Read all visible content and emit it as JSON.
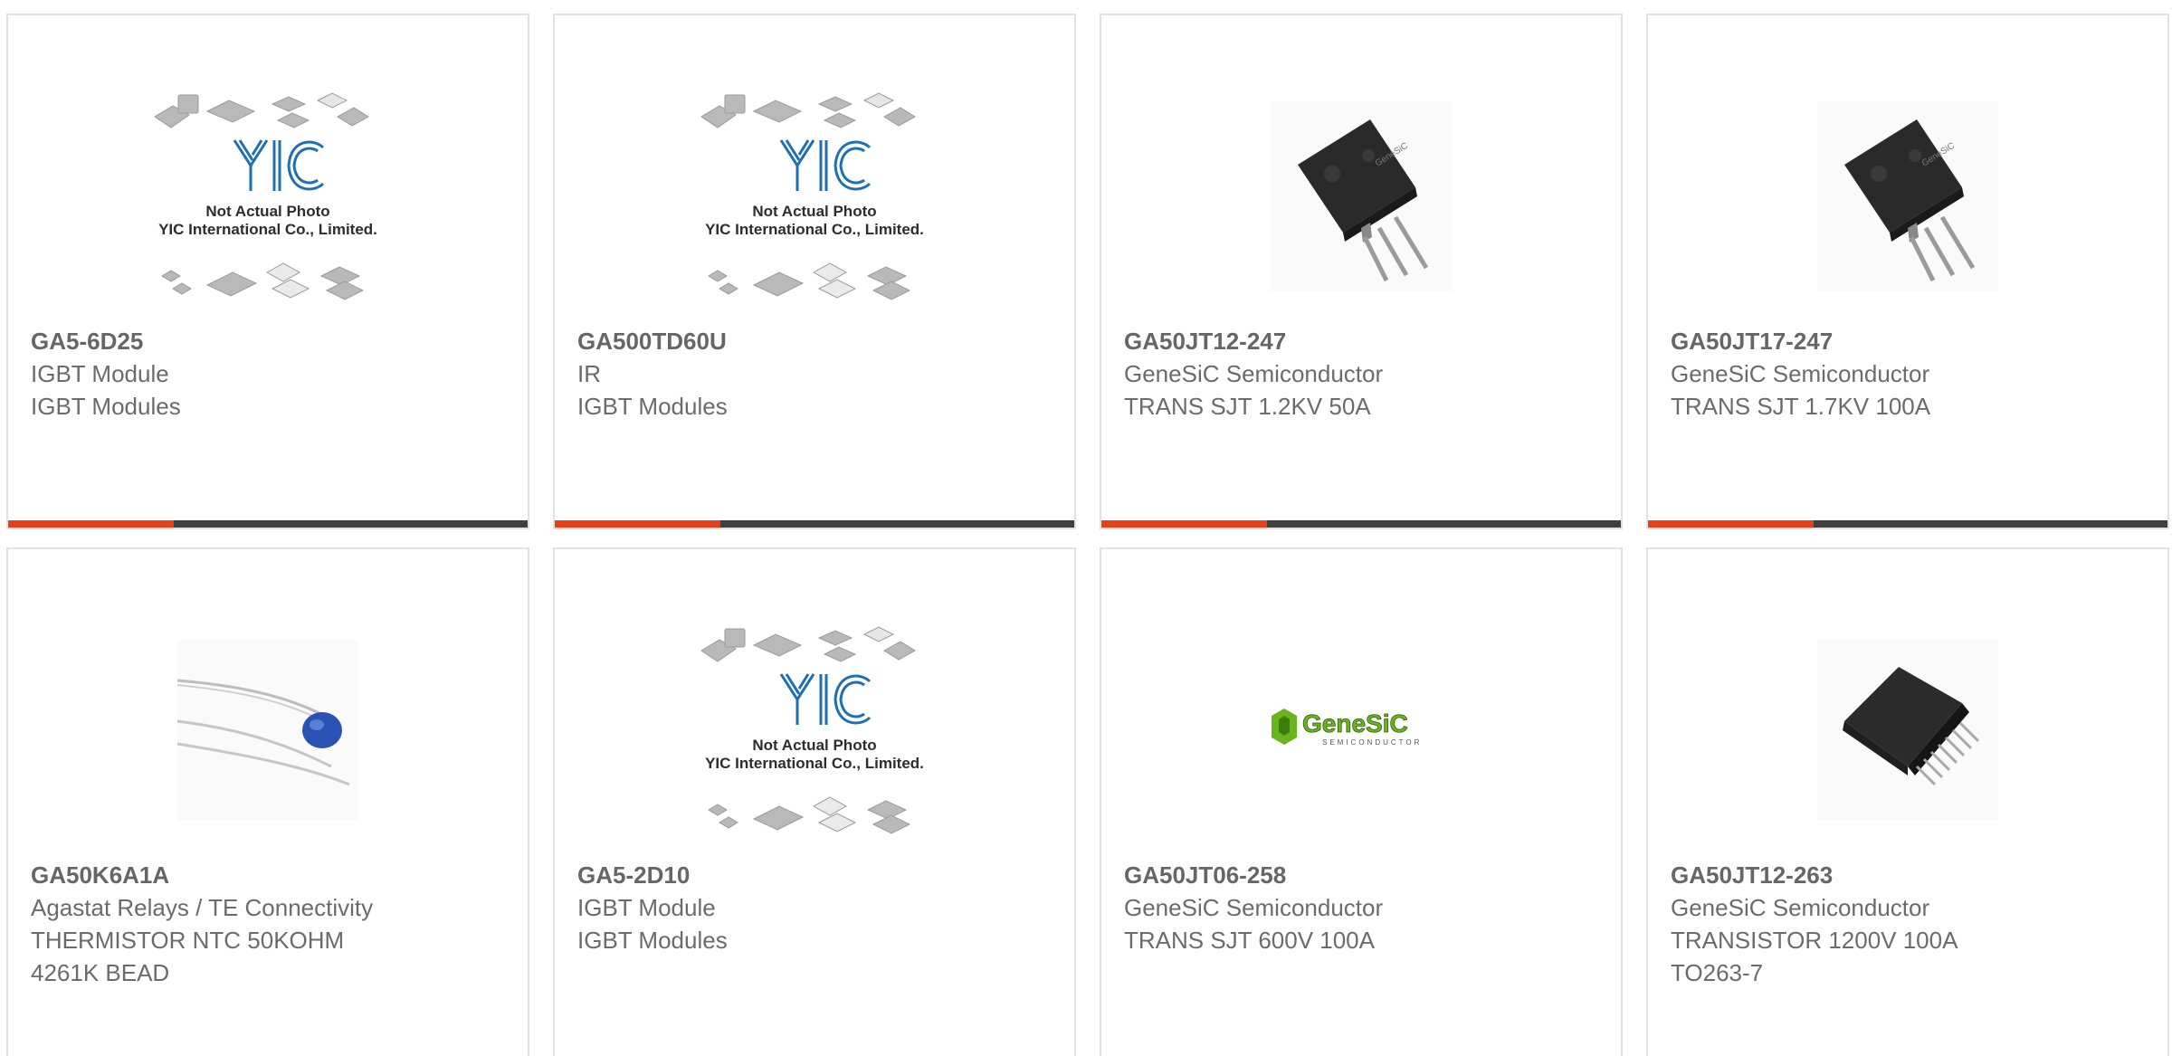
{
  "products": [
    {
      "part_number": "GA5-6D25",
      "lines": [
        "IGBT Module",
        "IGBT Modules"
      ],
      "image": "yic-placeholder",
      "image_caption": [
        "Not Actual Photo",
        "YIC International Co., Limited."
      ],
      "image_logo": "YIC"
    },
    {
      "part_number": "GA500TD60U",
      "lines": [
        "IR",
        "IGBT Modules"
      ],
      "image": "yic-placeholder",
      "image_caption": [
        "Not Actual Photo",
        "YIC International Co., Limited."
      ],
      "image_logo": "YIC"
    },
    {
      "part_number": "GA50JT12-247",
      "lines": [
        "GeneSiC Semiconductor",
        "TRANS SJT 1.2KV 50A"
      ],
      "image": "to247-transistor"
    },
    {
      "part_number": "GA50JT17-247",
      "lines": [
        "GeneSiC Semiconductor",
        "TRANS SJT 1.7KV 100A"
      ],
      "image": "to247-transistor"
    },
    {
      "part_number": "GA50K6A1A",
      "lines": [
        "Agastat Relays / TE Connectivity",
        "THERMISTOR NTC 50KOHM",
        "4261K BEAD"
      ],
      "image": "thermistor-bead"
    },
    {
      "part_number": "GA5-2D10",
      "lines": [
        "IGBT Module",
        "IGBT Modules"
      ],
      "image": "yic-placeholder",
      "image_caption": [
        "Not Actual Photo",
        "YIC International Co., Limited."
      ],
      "image_logo": "YIC"
    },
    {
      "part_number": "GA50JT06-258",
      "lines": [
        "GeneSiC Semiconductor",
        "TRANS SJT 600V 100A"
      ],
      "image": "genesic-logo",
      "image_logo": "GeneSiC",
      "image_logo_sub": "SEMICONDUCTOR"
    },
    {
      "part_number": "GA50JT12-263",
      "lines": [
        "GeneSiC Semiconductor",
        "TRANSISTOR 1200V 100A",
        "TO263-7"
      ],
      "image": "to263-package"
    }
  ],
  "colors": {
    "accent": "#e8411a",
    "bar": "#3f3f3f",
    "border": "#e2e2e2",
    "text": "#6b6b6b"
  }
}
